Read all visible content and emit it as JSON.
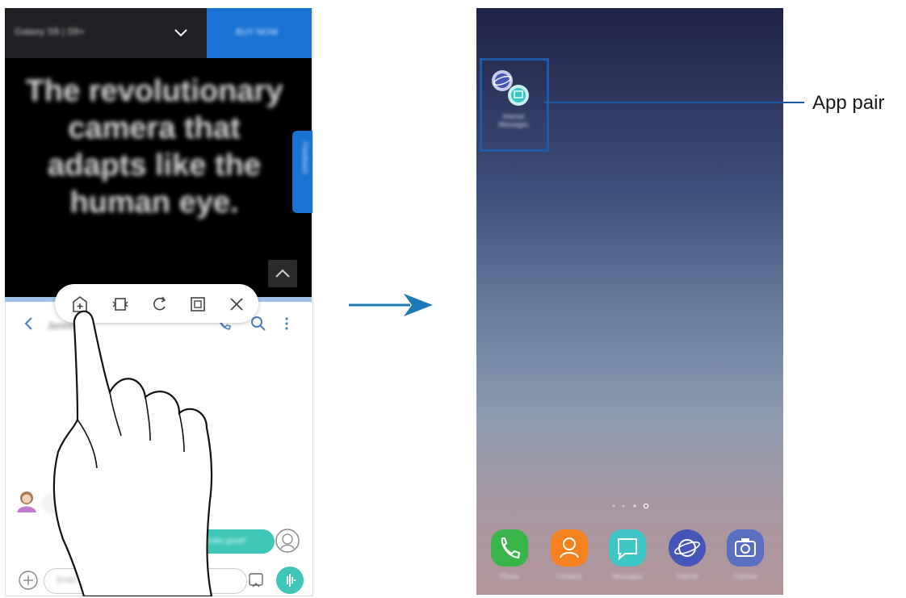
{
  "left_phone": {
    "top_bar": {
      "title": "Galaxy S9 | S9+",
      "button_label": "BUY NOW"
    },
    "video": {
      "headline": "The revolutionary camera that adapts like the human eye."
    },
    "feedback_tab": {
      "label": "Feedback"
    },
    "action_bar": {
      "icons": [
        "add-app-pair-icon",
        "switch-windows-icon",
        "rotate-icon",
        "pop-up-view-icon",
        "close-icon"
      ]
    },
    "conversation": {
      "contact_name": "Jennifer",
      "outgoing_message": "Looks good!",
      "compose_placeholder": "Enter message"
    }
  },
  "right_phone": {
    "app_pair": {
      "label": "Internet\nMessages"
    },
    "callout": "App pair",
    "dock": [
      {
        "label": "Phone",
        "color": "#39b54a",
        "icon": "phone-icon"
      },
      {
        "label": "Contacts",
        "color": "#f5821f",
        "icon": "contacts-icon"
      },
      {
        "label": "Messages",
        "color": "#3ec6c6",
        "icon": "messages-icon"
      },
      {
        "label": "Internet",
        "color": "#4656b8",
        "icon": "internet-icon"
      },
      {
        "label": "Camera",
        "color": "#5a6fc0",
        "icon": "camera-icon"
      }
    ]
  },
  "colors": {
    "highlight_blue": "#1d5aa8",
    "arrow_blue": "#1a79b8",
    "browser_blue": "#1a73d4"
  }
}
